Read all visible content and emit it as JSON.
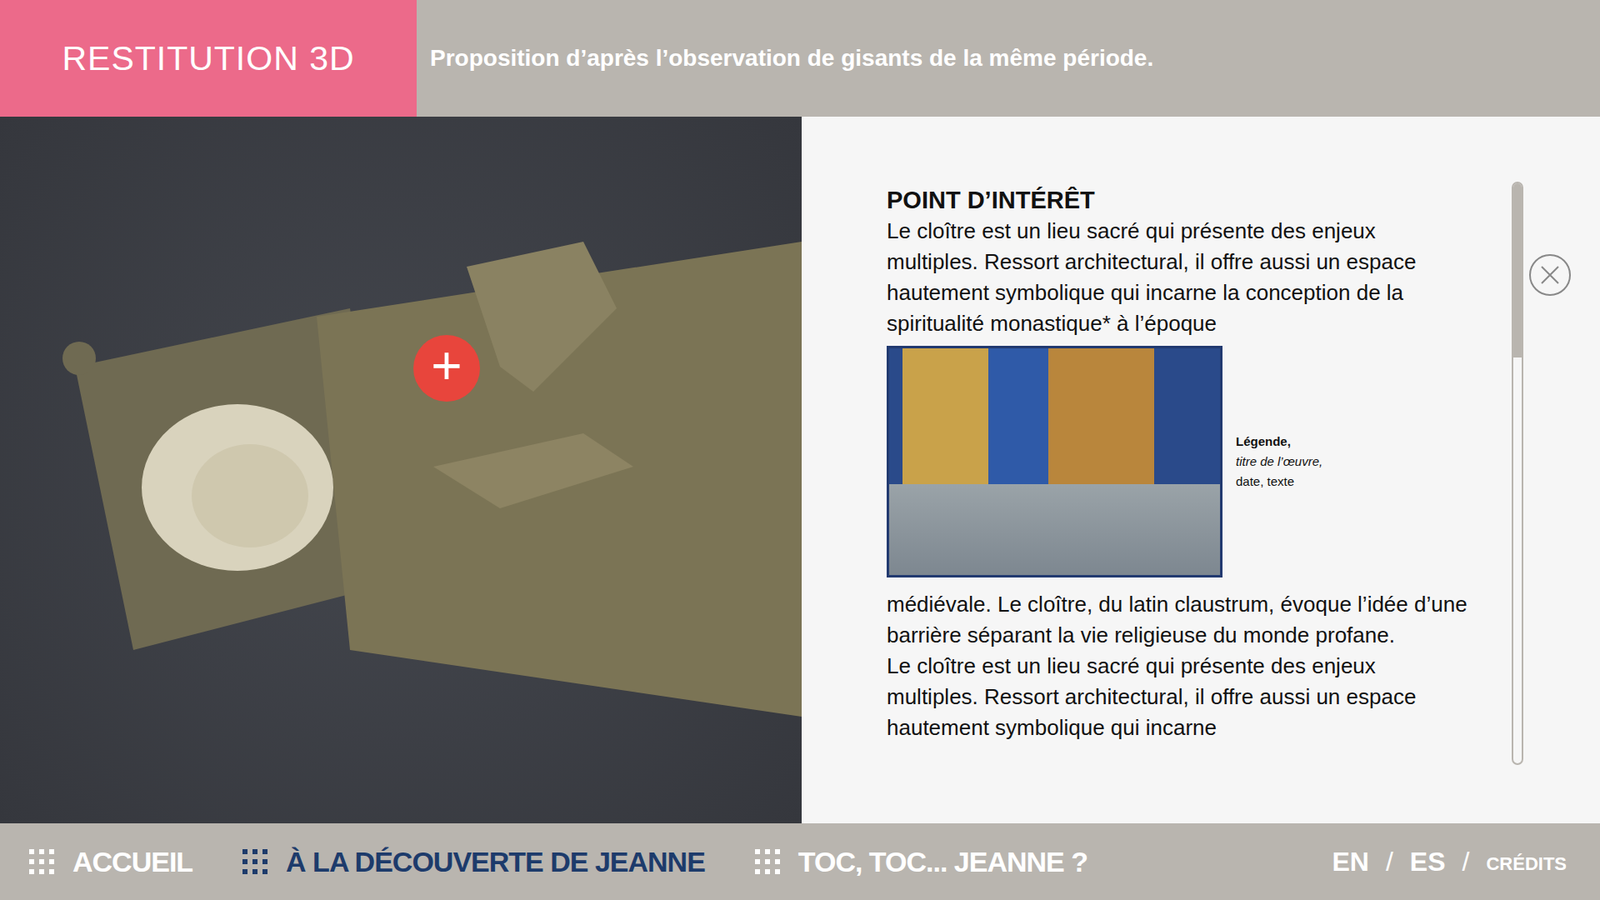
{
  "header": {
    "title": "RESTITUTION 3D",
    "subtitle": "Proposition d’après l’observation de gisants de la même période."
  },
  "viewer": {
    "hotspot": "+"
  },
  "panel": {
    "title": "POINT D’INTÉRÊT",
    "text_before": "Le cloître est un lieu sacré qui présente des enjeux multiples. Ressort architectural, il offre aussi un espace hautement symbolique qui incarne la conception de la spiritualité monastique* à l’époque",
    "figure": {
      "caption_title": "Légende,",
      "caption_work": "titre de l’œuvre,",
      "caption_details": "date, texte"
    },
    "text_after": [
      "médiévale. Le cloître, du latin claustrum, évoque l’idée d’une barrière séparant la vie religieuse du monde profane.",
      "Le cloître est un lieu sacré qui présente des enjeux multiples. Ressort architectural, il offre aussi un espace hautement symbolique qui incarne"
    ],
    "scroll": {
      "level": 0.3
    }
  },
  "nav": {
    "items": [
      {
        "label": "ACCUEIL",
        "selected": false
      },
      {
        "label": "À LA DÉCOUVERTE DE JEANNE",
        "selected": true
      },
      {
        "label": "TOC, TOC... JEANNE ?",
        "selected": false
      }
    ],
    "languages": [
      "EN",
      "ES"
    ],
    "separator": "/",
    "credits": "CRÉDITS"
  }
}
